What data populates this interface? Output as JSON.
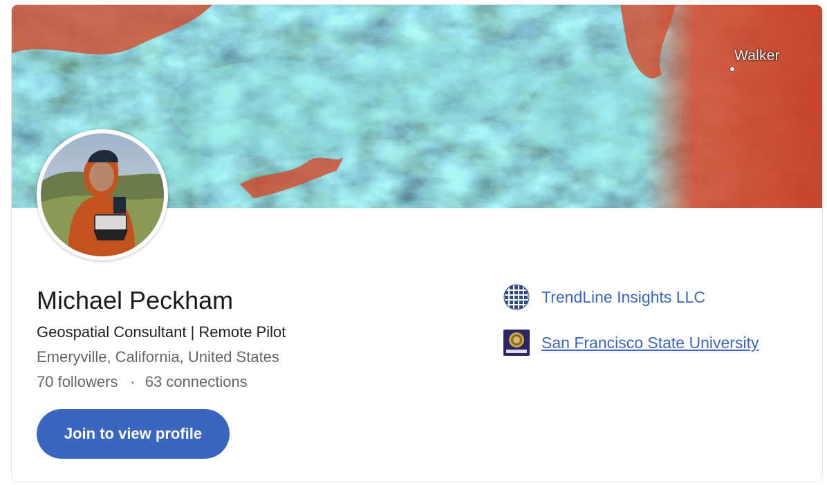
{
  "banner": {
    "place_label": "Walker"
  },
  "profile": {
    "name": "Michael Peckham",
    "headline": "Geospatial Consultant | Remote Pilot",
    "location": "Emeryville, California, United States",
    "followers": "70 followers",
    "separator": "·",
    "connections": "63 connections",
    "join_label": "Join to view profile"
  },
  "orgs": [
    {
      "name": "TrendLine Insights LLC",
      "icon": "trendline-logo-icon"
    },
    {
      "name": "San Francisco State University",
      "icon": "sfsu-seal-icon"
    }
  ],
  "colors": {
    "accent": "#3a66c0",
    "text_primary": "#1a1a1a",
    "text_secondary": "#666666"
  }
}
